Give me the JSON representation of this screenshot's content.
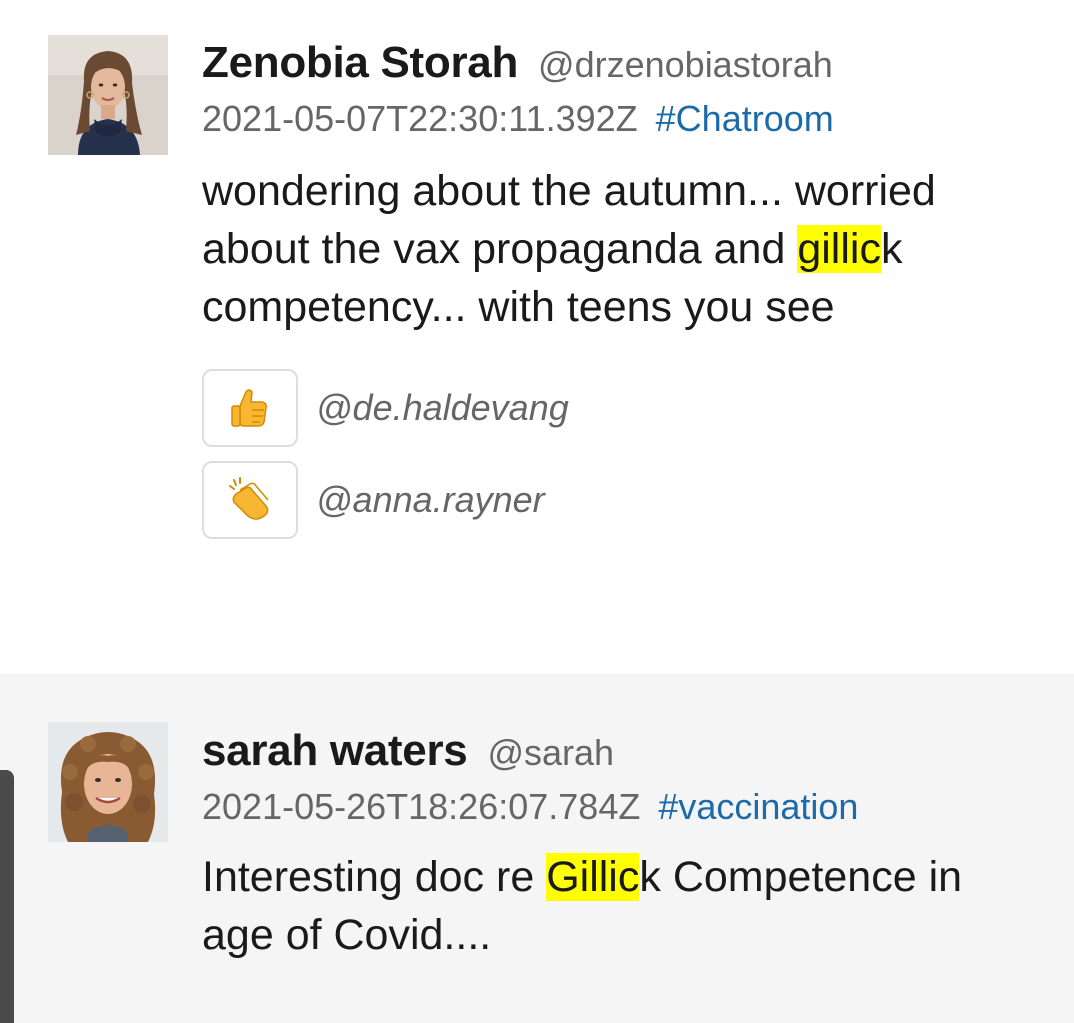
{
  "posts": [
    {
      "display_name": "Zenobia Storah",
      "username": "@drzenobiastorah",
      "timestamp": "2021-05-07T22:30:11.392Z",
      "channel": "#Chatroom",
      "message": {
        "part1": "wondering about the autumn... worried about the vax propaganda and ",
        "highlight": "gillic",
        "part2": "k competency... with teens you see"
      },
      "reactions": [
        {
          "emoji": "thumbs-up-icon",
          "user": "@de.haldevang"
        },
        {
          "emoji": "clapping-hands-icon",
          "user": "@anna.rayner"
        }
      ]
    },
    {
      "display_name": "sarah waters",
      "username": "@sarah",
      "timestamp": "2021-05-26T18:26:07.784Z",
      "channel": "#vaccination",
      "message": {
        "part1": "Interesting doc re ",
        "highlight": "Gillic",
        "part2": "k Competence in age of Covid...."
      }
    }
  ],
  "colors": {
    "highlight": "#ffff00",
    "channel_link": "#1c6aa8",
    "muted_text": "#666666",
    "second_post_bg": "#f5f5f5"
  }
}
